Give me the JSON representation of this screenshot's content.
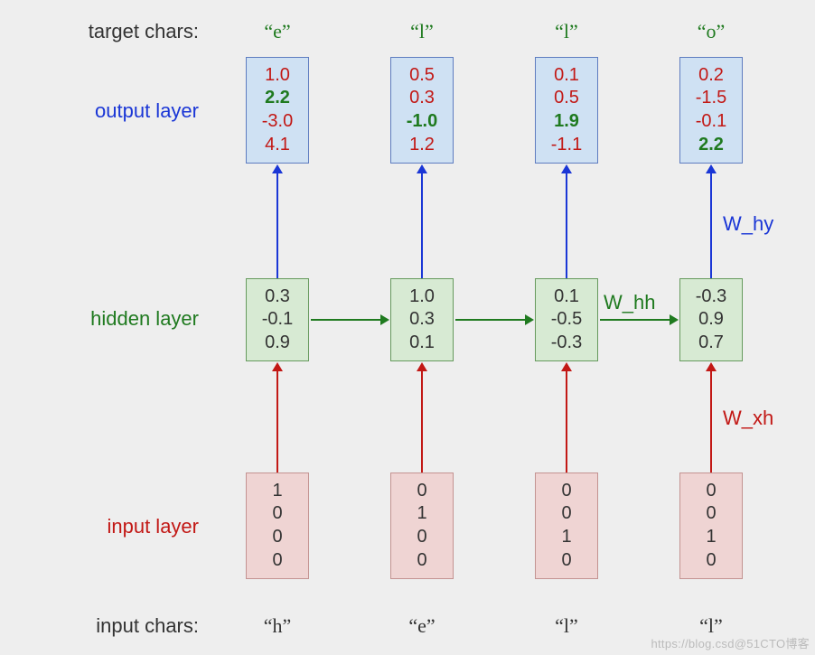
{
  "labels": {
    "target_chars": "target chars:",
    "output_layer": "output layer",
    "hidden_layer": "hidden layer",
    "input_layer": "input layer",
    "input_chars": "input chars:"
  },
  "weights": {
    "w_hy": "W_hy",
    "w_hh": "W_hh",
    "w_xh": "W_xh"
  },
  "columns": [
    {
      "input_char": "“h”",
      "target_char": "“e”",
      "input": [
        "1",
        "0",
        "0",
        "0"
      ],
      "hidden": [
        "0.3",
        "-0.1",
        "0.9"
      ],
      "output": [
        {
          "v": "1.0",
          "cls": "red"
        },
        {
          "v": "2.2",
          "cls": "green"
        },
        {
          "v": "-3.0",
          "cls": "red"
        },
        {
          "v": "4.1",
          "cls": "red"
        }
      ]
    },
    {
      "input_char": "“e”",
      "target_char": "“l”",
      "input": [
        "0",
        "1",
        "0",
        "0"
      ],
      "hidden": [
        "1.0",
        "0.3",
        "0.1"
      ],
      "output": [
        {
          "v": "0.5",
          "cls": "red"
        },
        {
          "v": "0.3",
          "cls": "red"
        },
        {
          "v": "-1.0",
          "cls": "green"
        },
        {
          "v": "1.2",
          "cls": "red"
        }
      ]
    },
    {
      "input_char": "“l”",
      "target_char": "“l”",
      "input": [
        "0",
        "0",
        "1",
        "0"
      ],
      "hidden": [
        "0.1",
        "-0.5",
        "-0.3"
      ],
      "output": [
        {
          "v": "0.1",
          "cls": "red"
        },
        {
          "v": "0.5",
          "cls": "red"
        },
        {
          "v": "1.9",
          "cls": "green"
        },
        {
          "v": "-1.1",
          "cls": "red"
        }
      ]
    },
    {
      "input_char": "“l”",
      "target_char": "“o”",
      "input": [
        "0",
        "0",
        "1",
        "0"
      ],
      "hidden": [
        "-0.3",
        "0.9",
        "0.7"
      ],
      "output": [
        {
          "v": "0.2",
          "cls": "red"
        },
        {
          "v": "-1.5",
          "cls": "red"
        },
        {
          "v": "-0.1",
          "cls": "red"
        },
        {
          "v": "2.2",
          "cls": "green"
        }
      ]
    }
  ],
  "watermark": "https://blog.csd@51CTO博客"
}
